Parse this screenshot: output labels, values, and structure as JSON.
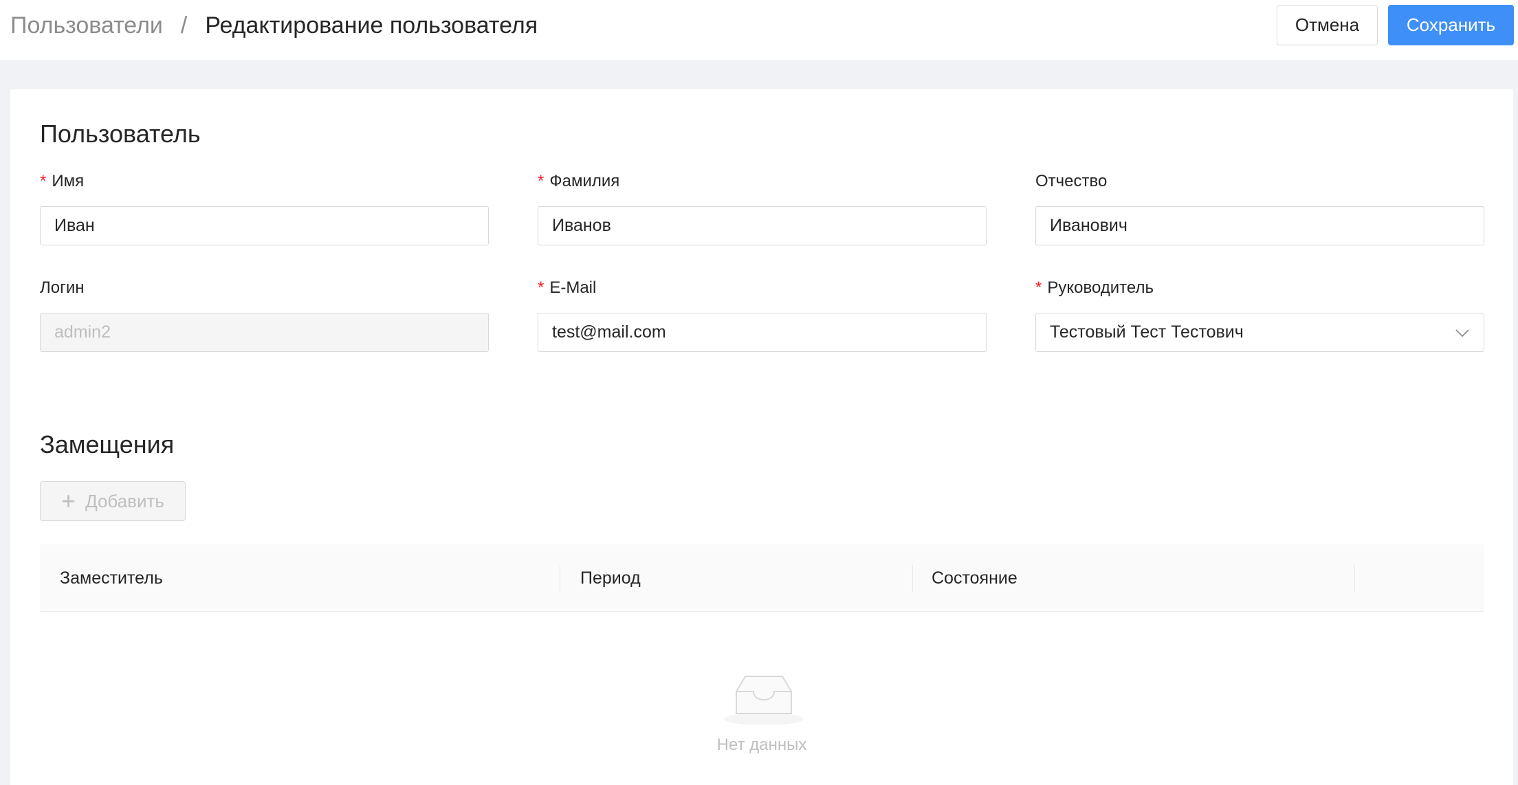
{
  "header": {
    "breadcrumb_parent": "Пользователи",
    "breadcrumb_separator": "/",
    "breadcrumb_current": "Редактирование пользователя",
    "cancel_label": "Отмена",
    "save_label": "Сохранить"
  },
  "user_section": {
    "title": "Пользователь",
    "required_mark": "*",
    "first_name": {
      "label": "Имя",
      "value": "Иван",
      "required": true
    },
    "last_name": {
      "label": "Фамилия",
      "value": "Иванов",
      "required": true
    },
    "middle_name": {
      "label": "Отчество",
      "value": "Иванович",
      "required": false
    },
    "login": {
      "label": "Логин",
      "value": "admin2",
      "required": false,
      "disabled": true
    },
    "email": {
      "label": "E-Mail",
      "value": "test@mail.com",
      "required": true
    },
    "manager": {
      "label": "Руководитель",
      "value": "Тестовый Тест Тестович",
      "required": true,
      "icon": "chevron-down-icon"
    }
  },
  "substitutions_section": {
    "title": "Замещения",
    "add_label": "Добавить",
    "add_icon": "plus-icon",
    "columns": [
      "Заместитель",
      "Период",
      "Состояние",
      ""
    ],
    "empty_text": "Нет данных",
    "empty_icon": "empty-inbox-icon"
  },
  "colors": {
    "primary": "#3f8ff8",
    "required": "#f5222d",
    "page_bg": "#f0f2f5"
  }
}
